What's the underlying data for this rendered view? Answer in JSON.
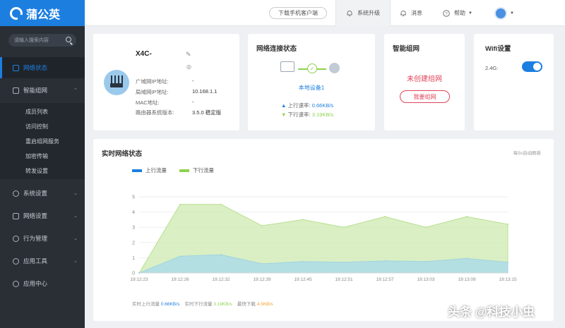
{
  "brand": {
    "name": "蒲公英"
  },
  "header": {
    "download_label": "下载手机客户端",
    "upgrade_label": "系统升级",
    "message_label": "消息",
    "help_label": "帮助"
  },
  "sidebar": {
    "search_placeholder": "请输入搜索内容",
    "items": [
      {
        "label": "网络状态",
        "icon": "dashboard-icon"
      },
      {
        "label": "智能组网",
        "icon": "mesh-icon"
      },
      {
        "label": "系统设置",
        "icon": "gear-icon"
      },
      {
        "label": "网络设置",
        "icon": "network-icon"
      },
      {
        "label": "行为管理",
        "icon": "behavior-icon"
      },
      {
        "label": "应用工具",
        "icon": "tools-icon"
      },
      {
        "label": "应用中心",
        "icon": "app-center-icon"
      }
    ],
    "sub_items": [
      "成员列表",
      "访问控制",
      "重启组网服务",
      "加密传输",
      "转发设置"
    ]
  },
  "device": {
    "name": "X4C-",
    "rows": [
      {
        "label": "广域网IP地址:",
        "value": "-"
      },
      {
        "label": "局域网IP地址:",
        "value": "10.168.1.1"
      },
      {
        "label": "MAC地址:",
        "value": "-"
      },
      {
        "label": "路由器系统版本:",
        "value": "3.5.0 稳定版"
      }
    ]
  },
  "network": {
    "title": "网络连接状态",
    "local_device": "本地设备1",
    "up_label": "上行速率:",
    "up_value": "0.66KB/s",
    "down_label": "下行速率:",
    "down_value": "3.19KB/s"
  },
  "mesh": {
    "title": "智能组网",
    "status": "未创建组网",
    "button": "我要组网"
  },
  "wifi": {
    "title": "Wifi设置",
    "band_label": "2.4G:",
    "enabled": true
  },
  "realtime": {
    "title": "实时网络状态",
    "refresh_note": "每5s自动刷新",
    "footer": {
      "up_label": "实时上行流量",
      "up_value": "0.66KB/s",
      "down_label": "实时下行流量",
      "down_value": "3.19KB/s",
      "max_label": "最快下载",
      "max_value": "4.5KB/s"
    }
  },
  "colors": {
    "accent": "#1c7fe0",
    "green": "#8fd14f",
    "red": "#e0445a",
    "orange": "#f0a030"
  },
  "chart_data": {
    "type": "area",
    "x": [
      "19:12:23",
      "19:12:26",
      "19:12:32",
      "19:12:39",
      "19:12:45",
      "19:12:51",
      "19:12:57",
      "19:13:03",
      "19:13:09",
      "19:13:15"
    ],
    "series": [
      {
        "name": "上行流量",
        "color": "#1c7fe0",
        "values": [
          0,
          1.1,
          1.2,
          0.6,
          0.75,
          0.7,
          0.8,
          0.75,
          0.95,
          0.7
        ]
      },
      {
        "name": "下行流量",
        "color": "#8fd14f",
        "values": [
          0,
          4.5,
          4.5,
          3.1,
          3.5,
          3.0,
          3.7,
          3.0,
          3.7,
          3.2
        ]
      }
    ],
    "yticks": [
      0,
      1,
      2,
      3,
      4,
      5
    ],
    "ylim": [
      0,
      5
    ],
    "grid": true,
    "legend_position": "top-left"
  }
}
